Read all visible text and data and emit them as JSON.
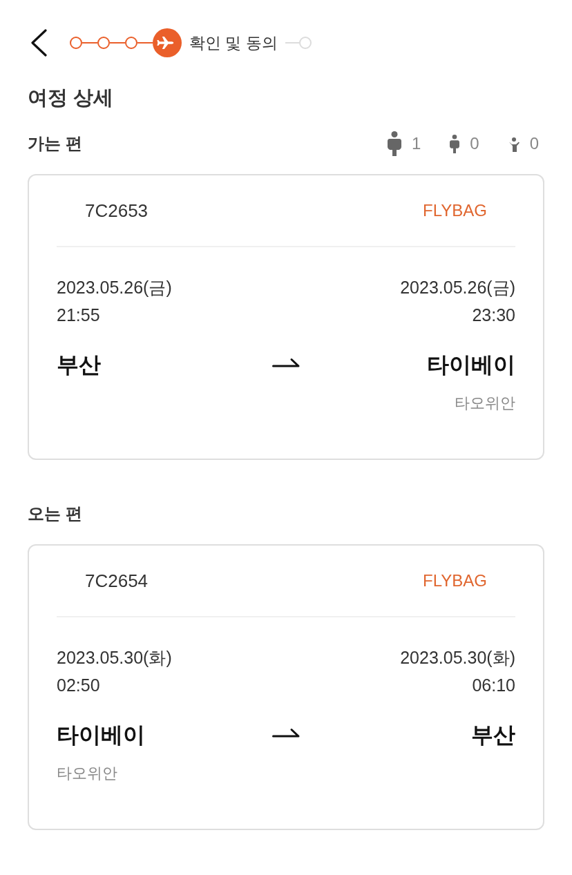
{
  "header": {
    "steps": [
      {
        "completed": true,
        "current": false
      },
      {
        "completed": true,
        "current": false
      },
      {
        "completed": true,
        "current": false
      },
      {
        "completed": false,
        "current": true,
        "label": "확인 및 동의"
      },
      {
        "completed": false,
        "current": false
      }
    ]
  },
  "title": "여정 상세",
  "passengers": [
    {
      "kind": "adult",
      "count": "1"
    },
    {
      "kind": "child",
      "count": "0"
    },
    {
      "kind": "infant",
      "count": "0"
    }
  ],
  "flights": [
    {
      "section_title": "가는 편",
      "flight_number": "7C2653",
      "fare_type": "FLYBAG",
      "departure": {
        "date": "2023.05.26(금)",
        "time": "21:55",
        "city": "부산"
      },
      "arrival": {
        "date": "2023.05.26(금)",
        "time": "23:30",
        "city": "타이베이",
        "airport": "타오위안"
      }
    },
    {
      "section_title": "오는 편",
      "flight_number": "7C2654",
      "fare_type": "FLYBAG",
      "departure": {
        "date": "2023.05.30(화)",
        "time": "02:50",
        "city": "타이베이",
        "airport": "타오위안"
      },
      "arrival": {
        "date": "2023.05.30(화)",
        "time": "06:10",
        "city": "부산"
      }
    }
  ]
}
